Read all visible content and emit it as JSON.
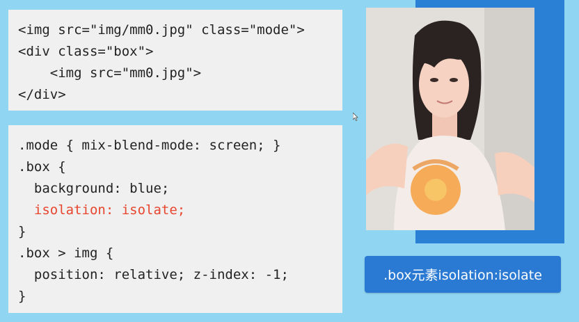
{
  "html_snippet": {
    "lines": [
      "<img src=\"img/mm0.jpg\" class=\"mode\">",
      "<div class=\"box\">",
      "    <img src=\"mm0.jpg\">",
      "</div>"
    ]
  },
  "css_snippet": {
    "lines": [
      ".mode { mix-blend-mode: screen; }",
      ".box {",
      "  background: blue;",
      "  isolation: isolate;",
      "}",
      ".box > img {",
      "  position: relative; z-index: -1;",
      "}"
    ],
    "highlight_color": "#e7452e"
  },
  "caption": {
    "label": ".box元素isolation:isolate"
  },
  "colors": {
    "background": "#90d6f3",
    "box_blue": "#2a80d5",
    "button_blue": "#2a7ad3",
    "code_panel": "#f0f0f0"
  },
  "image": {
    "src_name": "mm0.jpg"
  }
}
